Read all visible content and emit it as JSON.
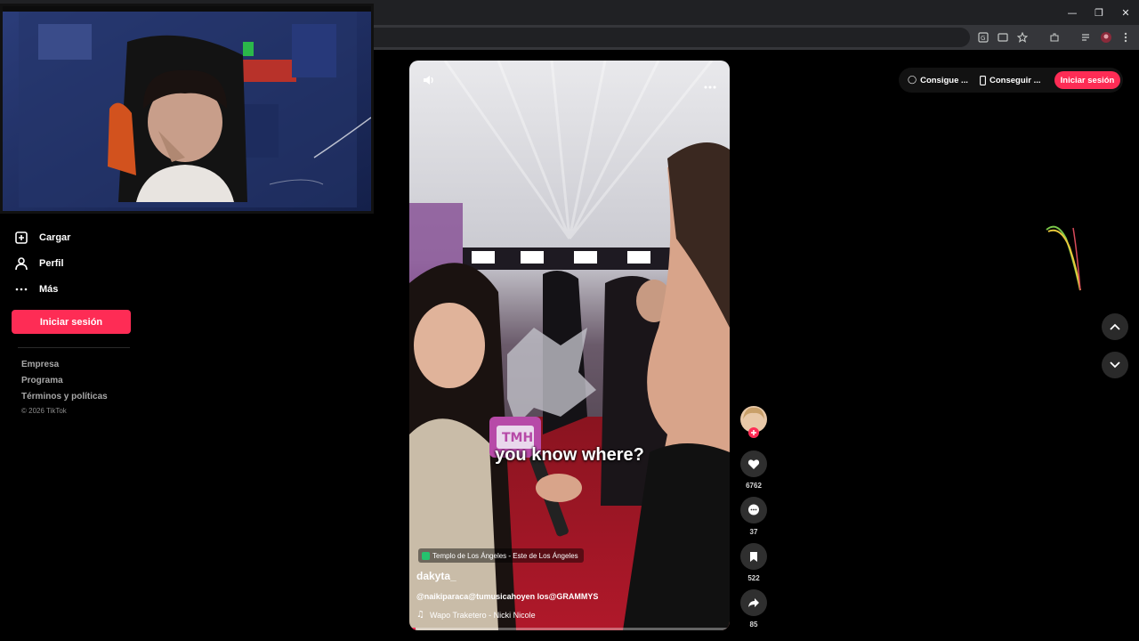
{
  "sidebar": {
    "items": [
      {
        "icon": "upload-icon",
        "label": "Cargar"
      },
      {
        "icon": "profile-icon",
        "label": "Perfil"
      },
      {
        "icon": "more-icon",
        "label": "Más"
      }
    ],
    "login_label": "Iniciar sesión",
    "footer_links": [
      "Empresa",
      "Programa",
      "Términos y políticas"
    ],
    "copyright": "© 2026 TikTok"
  },
  "video": {
    "caption": "you know where?",
    "location": "Templo de Los Ángeles - Este de Los Ángeles",
    "author": "dakyta_",
    "description": "@naikiparaca@tumusicahoyen los@GRAMMYS",
    "music": "Wapo Traketero - Nicki Nicole",
    "progress": 0.02
  },
  "actions": {
    "likes": "6762",
    "comments": "37",
    "saves": "522",
    "shares": "85"
  },
  "header": {
    "coins_label": "Consigue ...",
    "app_label": "Conseguir ...",
    "login_label": "Iniciar sesión"
  },
  "colors": {
    "accent": "#fe2c55",
    "background": "#000000"
  }
}
